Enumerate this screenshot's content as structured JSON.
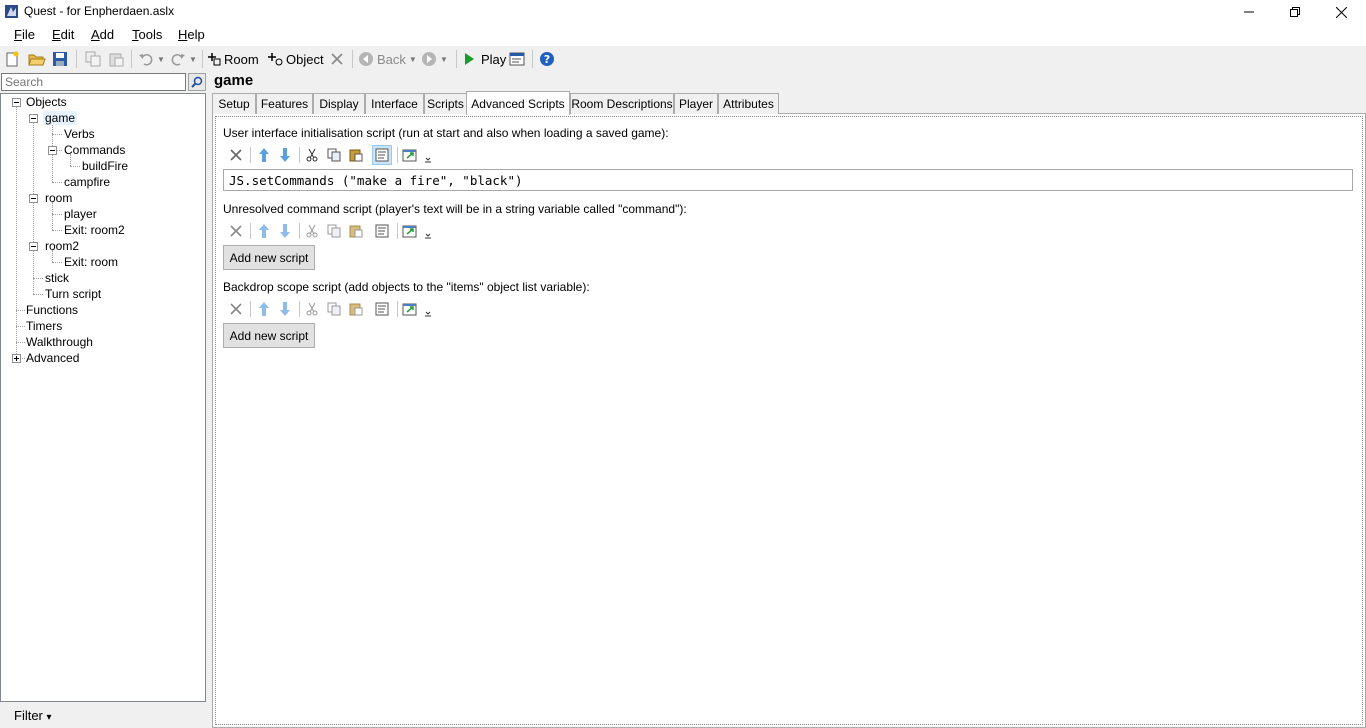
{
  "window": {
    "title": "Quest - for Enpherdaen.aslx"
  },
  "menu": {
    "items": [
      {
        "key": "F",
        "rest": "ile"
      },
      {
        "key": "E",
        "rest": "dit"
      },
      {
        "key": "A",
        "rest": "dd"
      },
      {
        "key": "T",
        "rest": "ools"
      },
      {
        "key": "H",
        "rest": "elp"
      }
    ]
  },
  "toolbar": {
    "room_label": "Room",
    "object_label": "Object",
    "back_label": "Back",
    "play_label": "Play"
  },
  "search": {
    "placeholder": "Search"
  },
  "tree": {
    "objects": "Objects",
    "game": "game",
    "verbs": "Verbs",
    "commands": "Commands",
    "buildfire": "buildFire",
    "campfire": "campfire",
    "room": "room",
    "player": "player",
    "exit_room2": "Exit: room2",
    "room2": "room2",
    "exit_room": "Exit: room",
    "stick": "stick",
    "turn_script": "Turn script",
    "functions": "Functions",
    "timers": "Timers",
    "walkthrough": "Walkthrough",
    "advanced": "Advanced"
  },
  "filter": {
    "label": "Filter",
    "arrow": "▾"
  },
  "editor": {
    "title": "game",
    "tabs": [
      "Setup",
      "Features",
      "Display",
      "Interface",
      "Scripts",
      "Advanced Scripts",
      "Room Descriptions",
      "Player",
      "Attributes"
    ],
    "active_tab": "Advanced Scripts",
    "ui_init_label": "User interface initialisation script (run at start and also when loading a saved game):",
    "ui_init_code": "JS.setCommands (\"make a fire\", \"black\")",
    "unresolved_label": "Unresolved command script (player's text will be in a string variable called \"command\"):",
    "backdrop_label": "Backdrop scope script (add objects to the \"items\" object list variable):",
    "add_new_script": "Add new script"
  }
}
